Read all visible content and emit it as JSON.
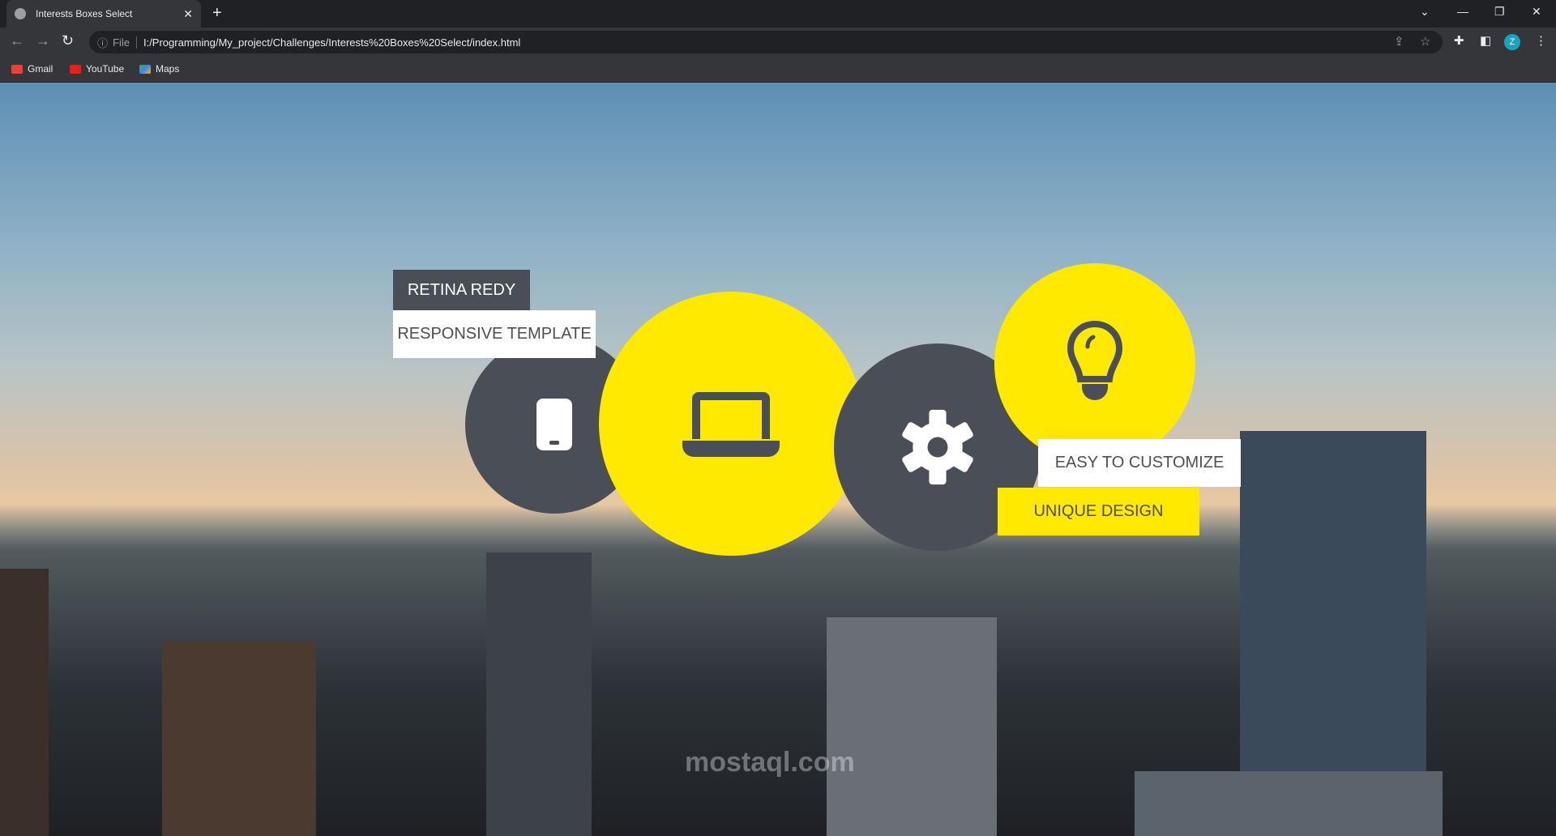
{
  "browser": {
    "tab_title": "Interests Boxes Select",
    "address_prefix": "File",
    "url": "I:/Programming/My_project/Challenges/Interests%20Boxes%20Select/index.html",
    "profile_initial": "Z",
    "bookmarks": [
      {
        "label": "Gmail"
      },
      {
        "label": "YouTube"
      },
      {
        "label": "Maps"
      }
    ]
  },
  "page": {
    "labels": {
      "retina": "RETINA REDY",
      "responsive": "RESPONSIVE TEMPLATE",
      "customize": "EASY TO CUSTOMIZE",
      "unique": "UNIQUE DESIGN"
    },
    "watermark": "mostaql.com",
    "colors": {
      "yellow": "#ffe900",
      "gray": "#4a4f57"
    }
  }
}
